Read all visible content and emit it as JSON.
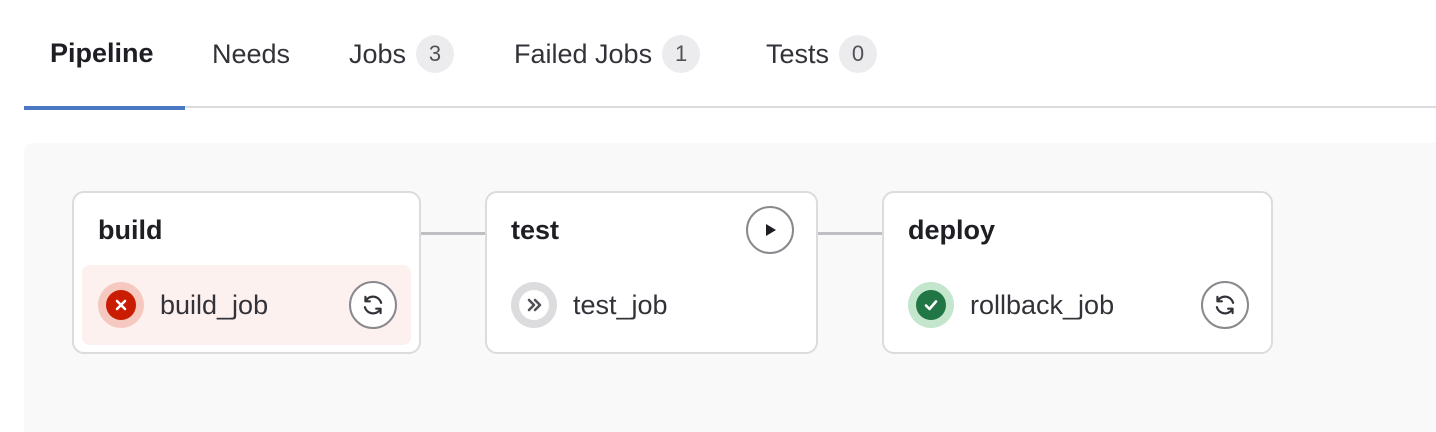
{
  "tabs": [
    {
      "label": "Pipeline",
      "active": true
    },
    {
      "label": "Needs"
    },
    {
      "label": "Jobs",
      "count": "3"
    },
    {
      "label": "Failed Jobs",
      "count": "1"
    },
    {
      "label": "Tests",
      "count": "0"
    }
  ],
  "stages": [
    {
      "title": "build",
      "job": {
        "name": "build_job",
        "status": "failed",
        "action": "retry-icon"
      }
    },
    {
      "title": "test",
      "stage_action": "play-icon",
      "job": {
        "name": "test_job",
        "status": "skipped"
      }
    },
    {
      "title": "deploy",
      "job": {
        "name": "rollback_job",
        "status": "success",
        "action": "retry-icon"
      }
    }
  ],
  "colors": {
    "accent": "#4b78c5",
    "failed": "#c91c00",
    "success": "#217645"
  }
}
